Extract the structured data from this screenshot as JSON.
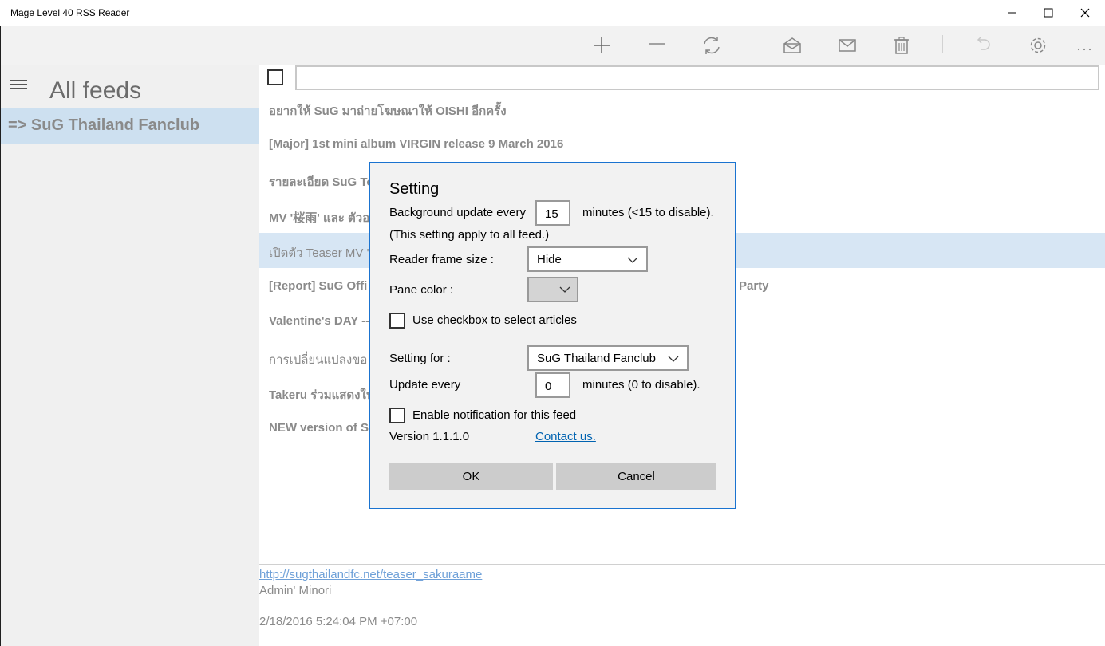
{
  "window": {
    "title": "Mage Level 40 RSS Reader"
  },
  "sidebar": {
    "heading": "All feeds",
    "selected_feed": "=> SuG Thailand Fanclub"
  },
  "toolbar": {
    "icons": [
      "add-icon",
      "remove-icon",
      "refresh-icon",
      "mark-read-icon",
      "mark-unread-icon",
      "delete-icon",
      "undo-icon",
      "settings-icon",
      "more-icon"
    ]
  },
  "search": {
    "value": ""
  },
  "articles": [
    {
      "text": "อยากให้ SuG มาถ่ายโฆษณาให้ OISHI อีกครั้ง",
      "bold": true
    },
    {
      "text": "[Major] 1st mini album VIRGIN release 9 March 2016",
      "bold": true
    },
    {
      "text": "รายละเอียด SuG To",
      "bold": true
    },
    {
      "text": "MV  '桜雨' และ ตัวอ",
      "bold": true
    },
    {
      "text": "เปิดตัว Teaser MV '桜",
      "bold": false,
      "highlighted": true
    },
    {
      "text": "[Report] SuG Offi",
      "bold": true,
      "tail": "Party"
    },
    {
      "text": "Valentine's DAY --",
      "bold": true
    },
    {
      "text": "การเปลี่ยนแปลงขอ",
      "bold": false
    },
    {
      "text": "Takeru ร่วมแสดงใน",
      "bold": true
    },
    {
      "text": "NEW version of S",
      "bold": true
    }
  ],
  "detail": {
    "link": "http://sugthailandfc.net/teaser_sakuraame",
    "author": "Admin' Minori",
    "date": "2/18/2016 5:24:04 PM +07:00"
  },
  "dialog": {
    "title": "Setting",
    "bg_update_label": "Background update every",
    "bg_update_value": "15",
    "bg_update_suffix": "minutes (<15 to disable).",
    "apply_note": "(This setting apply to all feed.)",
    "reader_frame_label": "Reader frame size :",
    "reader_frame_value": "Hide",
    "pane_color_label": "Pane color :",
    "checkbox_select_label": "Use checkbox to select articles",
    "setting_for_label": "Setting for :",
    "setting_for_value": "SuG Thailand Fanclub",
    "update_every_label": "Update every",
    "update_every_value": "0",
    "update_every_suffix": "minutes (0 to disable).",
    "notification_label": "Enable notification for this feed",
    "version": "Version 1.1.1.0",
    "contact": "Contact us.",
    "ok": "OK",
    "cancel": "Cancel"
  }
}
